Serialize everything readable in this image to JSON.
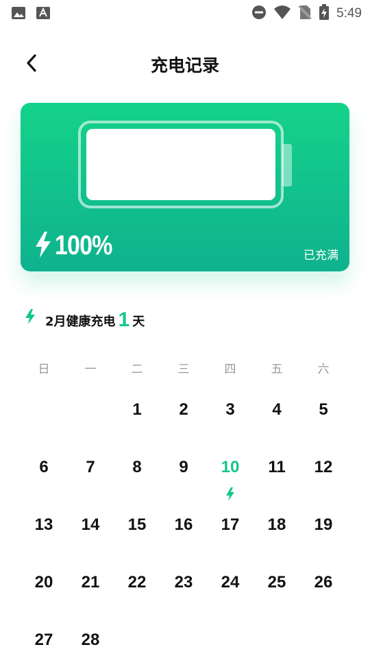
{
  "status_bar": {
    "time": "5:49",
    "left_icons": [
      "image-icon",
      "font-icon"
    ],
    "right_icons": [
      "dnd-icon",
      "wifi-icon",
      "no-sim-icon",
      "battery-charging-icon"
    ]
  },
  "header": {
    "title": "充电记录",
    "back_icon": "chevron-left-icon"
  },
  "battery_card": {
    "percent": "100%",
    "level": 1.0,
    "status": "已充满",
    "colors": {
      "start": "#15d28a",
      "end": "#0fb28e"
    }
  },
  "summary": {
    "prefix": "2月健康充电",
    "count": "1",
    "unit": "天"
  },
  "weekdays": [
    "日",
    "一",
    "二",
    "三",
    "四",
    "五",
    "六"
  ],
  "calendar": {
    "days": [
      "",
      "",
      "1",
      "2",
      "3",
      "4",
      "5",
      "6",
      "7",
      "8",
      "9",
      "10",
      "11",
      "12",
      "13",
      "14",
      "15",
      "16",
      "17",
      "18",
      "19",
      "20",
      "21",
      "22",
      "23",
      "24",
      "25",
      "26",
      "27",
      "28"
    ],
    "charged_days": [
      "10"
    ],
    "accent": "#12c78b"
  }
}
